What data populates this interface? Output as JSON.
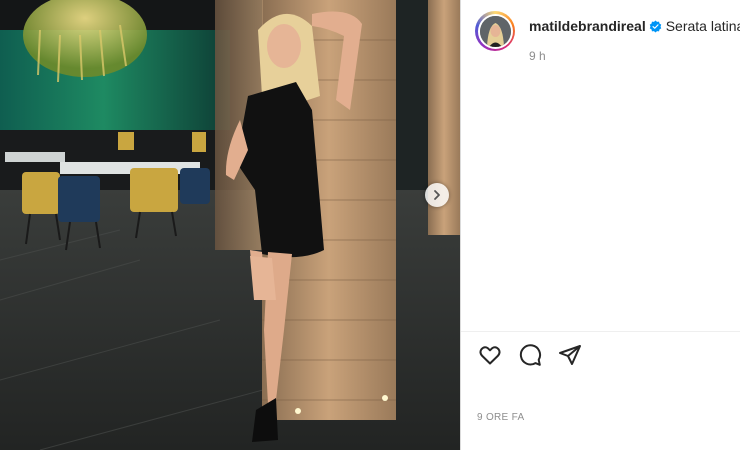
{
  "post": {
    "username": "matildebrandireal",
    "caption": "Serata latina",
    "relative_time": "9 h",
    "date_label": "9 ORE FA"
  },
  "icons": {
    "verified": "verified-badge-icon",
    "like": "heart-icon",
    "comment": "comment-icon",
    "share": "paper-plane-icon",
    "next": "chevron-right-icon"
  },
  "colors": {
    "verified_blue": "#0095f6",
    "text": "#262626",
    "muted": "#8e8e8e"
  }
}
